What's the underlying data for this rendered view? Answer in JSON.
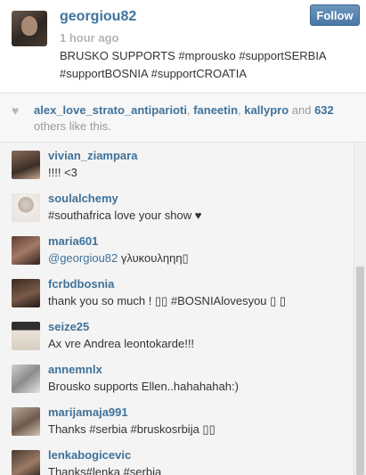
{
  "post": {
    "username": "georgiou82",
    "time": "1 hour ago",
    "caption_line1": "BRUSKO SUPPORTS #mprousko #supportSERBIA",
    "caption_line2": "#supportBOSNIA #supportCROATIA",
    "follow_label": "Follow"
  },
  "likes": {
    "likers": [
      "alex_love_strato_antiparioti",
      "faneetin",
      "kallypro"
    ],
    "sep1": ", ",
    "sep2": ", ",
    "and_text": " and ",
    "count": "632",
    "suffix": "others like this."
  },
  "comments": [
    {
      "user": "vivian_ziampara",
      "text": "!!!! <3"
    },
    {
      "user": "soulalchemy",
      "text": "#southafrica love your show ♥"
    },
    {
      "user": "maria601",
      "mention": "@georgiou82",
      "text": " γλυκουληηη▯"
    },
    {
      "user": "fcrbdbosnia",
      "text": "thank you so much ! ▯▯ #BOSNIAlovesyou ▯ ▯"
    },
    {
      "user": "seize25",
      "text": "Ax vre Andrea leontokarde!!!"
    },
    {
      "user": "annemnlx",
      "text": "Brousko supports Ellen..hahahahah:)"
    },
    {
      "user": "marijamaja991",
      "text": "Thanks #serbia #bruskosrbija ▯▯"
    },
    {
      "user": "lenkabogicevic",
      "text": "Thanks#lenka #serbia"
    }
  ],
  "colors": {
    "link": "#3f729b",
    "follow_bg": "#4a78a6",
    "meta_gray": "#b4b4b4"
  },
  "icons": {
    "heart": "heart-icon"
  }
}
